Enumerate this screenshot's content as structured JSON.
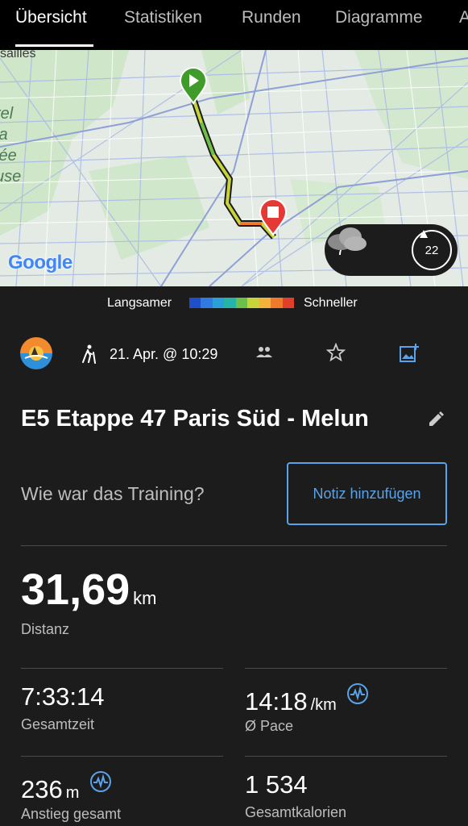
{
  "tabs": [
    "Übersicht",
    "Statistiken",
    "Runden",
    "Diagramme",
    "A"
  ],
  "map": {
    "place_labels": [
      "rel",
      "la",
      "lée",
      "use"
    ],
    "top_label": "sailles",
    "provider": "Google",
    "weather": {
      "temp": "7°",
      "wind": "22"
    }
  },
  "legend": {
    "slower": "Langsamer",
    "faster": "Schneller",
    "colors": [
      "#1f4fc7",
      "#2f7be0",
      "#2aa0d8",
      "#26b4a8",
      "#6cc04a",
      "#c6d43a",
      "#f2b33a",
      "#ef7a2a",
      "#e0402b"
    ]
  },
  "activity": {
    "date": "21. Apr. @ 10:29",
    "title": "E5 Etappe 47 Paris Süd - Melun",
    "question": "Wie war das Training?",
    "note_button": "Notiz hinzufügen"
  },
  "stats": {
    "distance": {
      "value": "31,69",
      "unit": "km",
      "label": "Distanz"
    },
    "total_time": {
      "value": "7:33:14",
      "label": "Gesamtzeit"
    },
    "pace": {
      "value": "14:18",
      "unit": "/km",
      "label": "Ø Pace"
    },
    "ascent": {
      "value": "236",
      "unit": "m",
      "label": "Anstieg gesamt"
    },
    "calories": {
      "value": "1 534",
      "label": "Gesamtkalorien"
    }
  },
  "colors": {
    "accent": "#5aa3e8",
    "background": "#1c1c1c",
    "start_marker": "#3f9b2a",
    "end_marker": "#e53935"
  }
}
